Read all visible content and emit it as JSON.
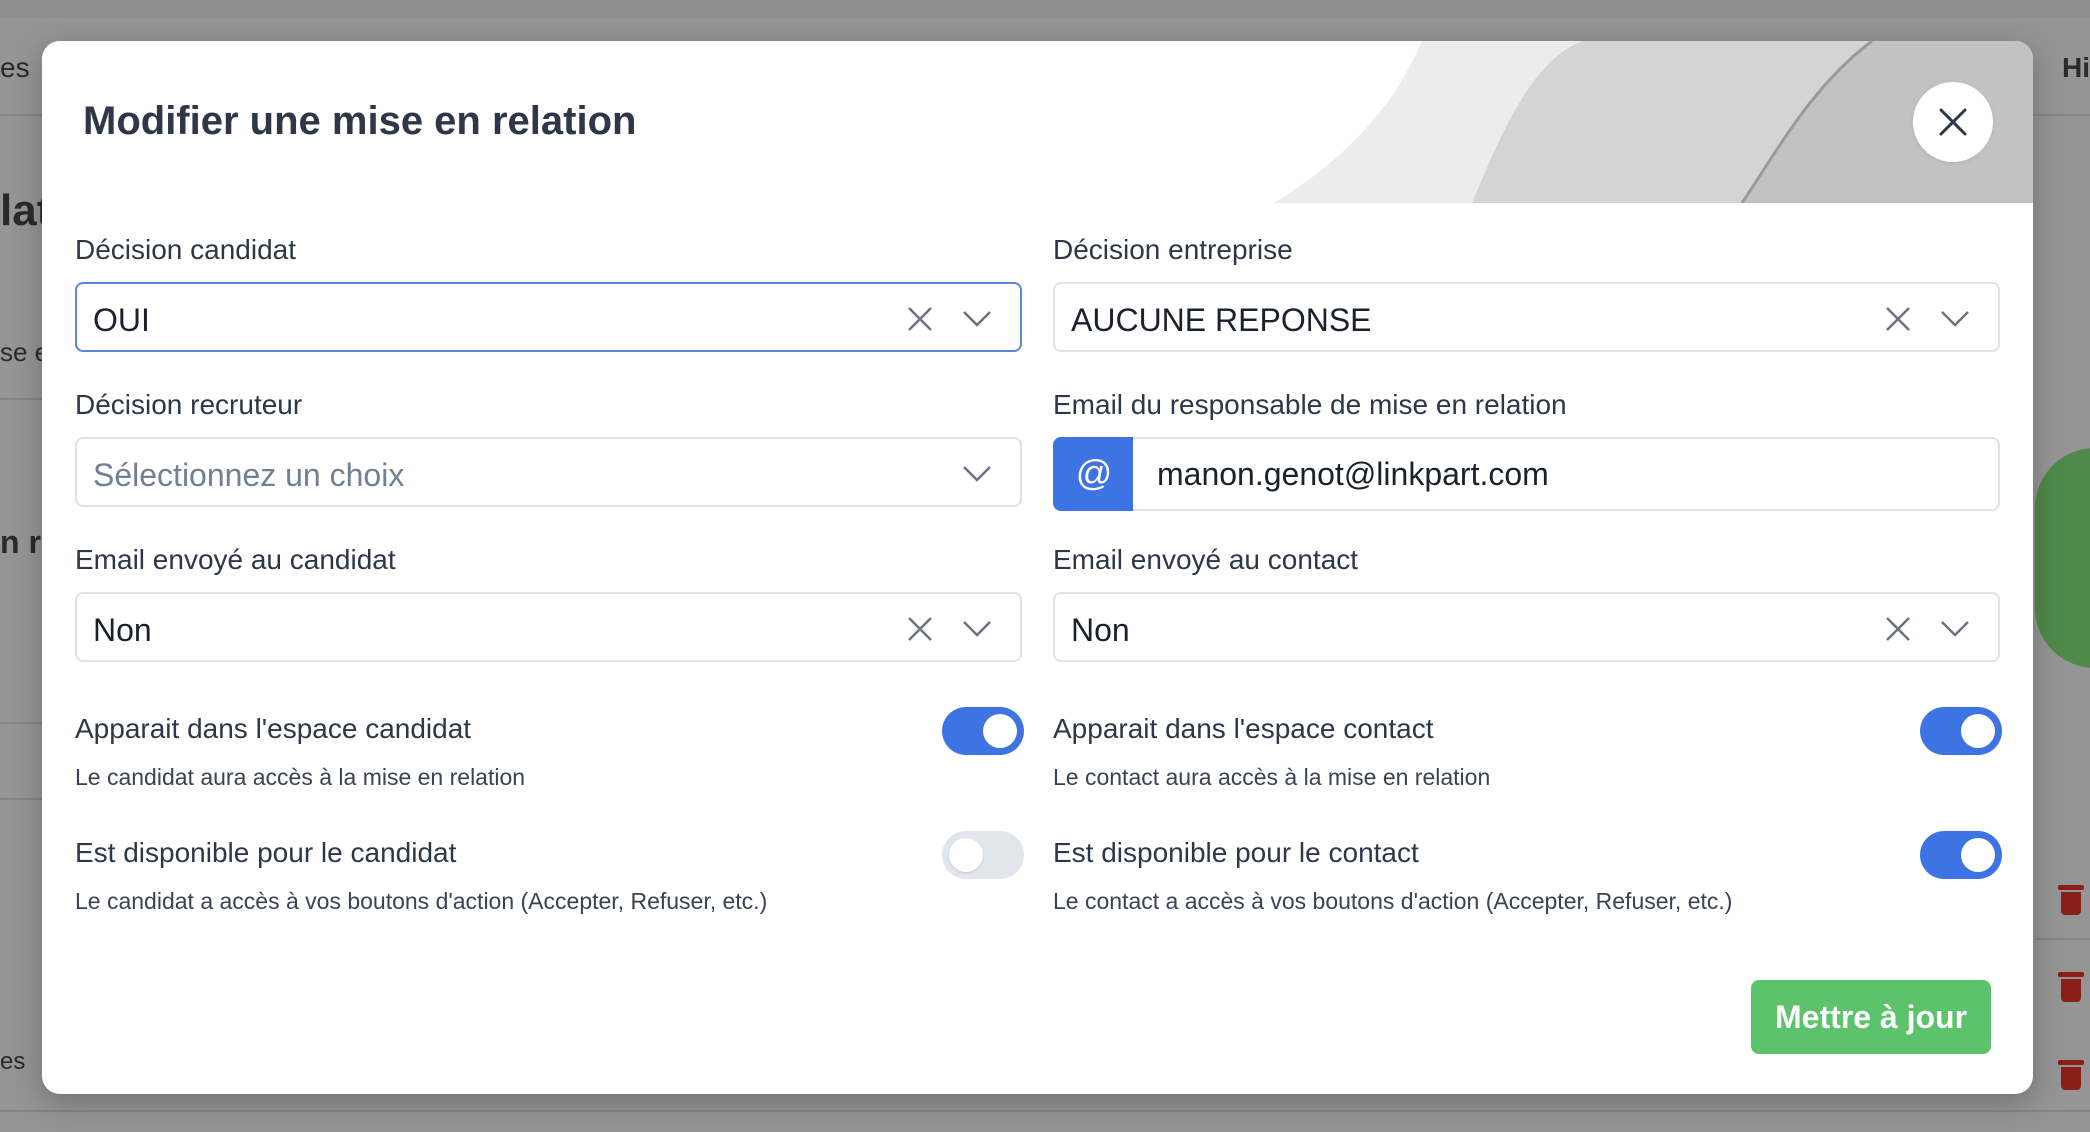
{
  "background": {
    "fragments": [
      "es",
      "lat",
      "se e",
      "n r",
      "es",
      "Hi"
    ]
  },
  "modal": {
    "title": "Modifier une mise en relation",
    "close_icon": "close-icon",
    "fields": {
      "decision_candidat": {
        "label": "Décision candidat",
        "value": "OUI"
      },
      "decision_entreprise": {
        "label": "Décision entreprise",
        "value": "AUCUNE REPONSE"
      },
      "decision_recruteur": {
        "label": "Décision recruteur",
        "placeholder": "Sélectionnez un choix"
      },
      "email_responsable": {
        "label": "Email du responsable de mise en relation",
        "addon": "@",
        "value": "manon.genot@linkpart.com"
      },
      "email_candidat": {
        "label": "Email envoyé au candidat",
        "value": "Non"
      },
      "email_contact": {
        "label": "Email envoyé au contact",
        "value": "Non"
      }
    },
    "toggles": {
      "espace_candidat": {
        "label": "Apparait dans l'espace candidat",
        "help": "Le candidat aura accès à la mise en relation",
        "on": true
      },
      "espace_contact": {
        "label": "Apparait dans l'espace contact",
        "help": "Le contact aura accès à la mise en relation",
        "on": true
      },
      "dispo_candidat": {
        "label": "Est disponible pour le candidat",
        "help": "Le candidat a accès à vos boutons d'action (Accepter, Refuser, etc.)",
        "on": false
      },
      "dispo_contact": {
        "label": "Est disponible pour le contact",
        "help": "Le contact a accès à vos boutons d'action (Accepter, Refuser, etc.)",
        "on": true
      }
    },
    "submit_label": "Mettre à jour"
  },
  "colors": {
    "primary": "#3e73e3",
    "success": "#5cc26b",
    "text": "#2d3748"
  }
}
